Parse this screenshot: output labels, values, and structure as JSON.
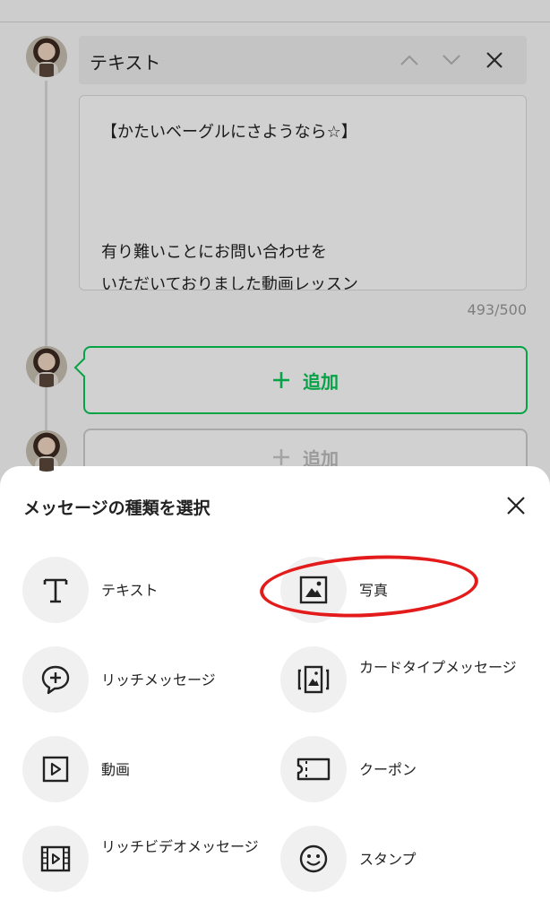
{
  "composer": {
    "message_type": "テキスト",
    "message_lines": [
      "【かたいベーグルにさようなら☆】",
      "",
      "",
      "有り難いことにお問い合わせを",
      "いただいておりました動画レッスン"
    ],
    "char_counter": "493/500",
    "add_label": "追加",
    "add_label_2": "追加"
  },
  "sheet": {
    "title": "メッセージの種類を選択",
    "options": [
      {
        "label": "テキスト",
        "icon": "text-icon"
      },
      {
        "label": "写真",
        "icon": "photo-icon"
      },
      {
        "label": "リッチメッセージ",
        "icon": "rich-message-icon"
      },
      {
        "label": "カードタイプメッセージ",
        "icon": "card-type-icon"
      },
      {
        "label": "動画",
        "icon": "video-icon"
      },
      {
        "label": "クーポン",
        "icon": "coupon-icon"
      },
      {
        "label": "リッチビデオメッセージ",
        "icon": "rich-video-icon"
      },
      {
        "label": "スタンプ",
        "icon": "sticker-icon"
      }
    ]
  },
  "colors": {
    "accent_green": "#06c755",
    "highlight_red": "#e31b1b"
  }
}
